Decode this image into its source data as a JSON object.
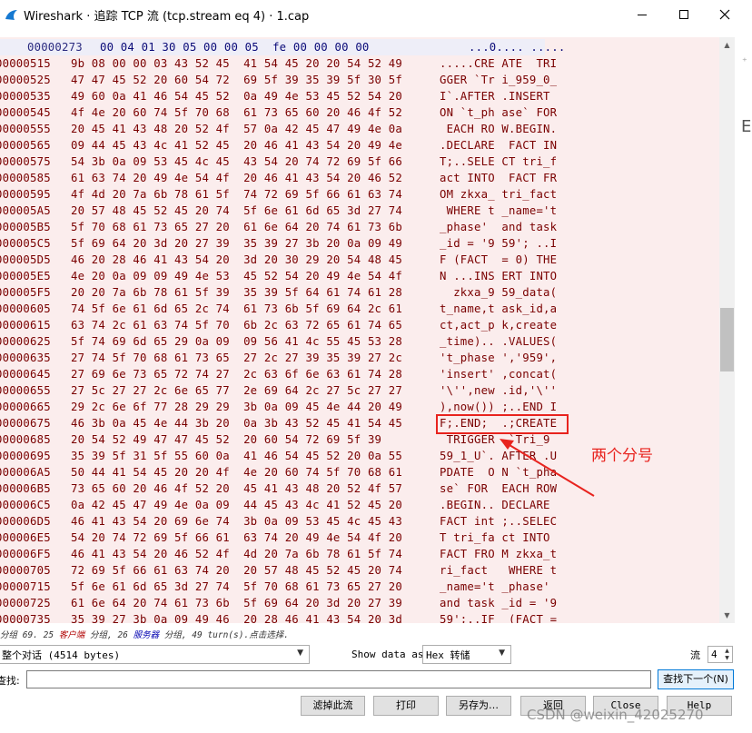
{
  "window": {
    "title": "Wireshark · 追踪 TCP 流 (tcp.stream eq 4) · 1.cap"
  },
  "stream": {
    "header_row": {
      "offset": "00000273",
      "hex": "00 04 01 30 05 00 00 05  fe 00 00 00 00",
      "ascii": "...0.... ....."
    },
    "rows": [
      {
        "offset": "00000515",
        "hex": "9b 08 00 00 03 43 52 45  41 54 45 20 20 54 52 49",
        "ascii": ".....CRE ATE  TRI"
      },
      {
        "offset": "00000525",
        "hex": "47 47 45 52 20 60 54 72  69 5f 39 35 39 5f 30 5f",
        "ascii": "GGER `Tr i_959_0_"
      },
      {
        "offset": "00000535",
        "hex": "49 60 0a 41 46 54 45 52  0a 49 4e 53 45 52 54 20",
        "ascii": "I`.AFTER .INSERT "
      },
      {
        "offset": "00000545",
        "hex": "4f 4e 20 60 74 5f 70 68  61 73 65 60 20 46 4f 52",
        "ascii": "ON `t_ph ase` FOR"
      },
      {
        "offset": "00000555",
        "hex": "20 45 41 43 48 20 52 4f  57 0a 42 45 47 49 4e 0a",
        "ascii": " EACH RO W.BEGIN."
      },
      {
        "offset": "00000565",
        "hex": "09 44 45 43 4c 41 52 45  20 46 41 43 54 20 49 4e",
        "ascii": ".DECLARE  FACT IN"
      },
      {
        "offset": "00000575",
        "hex": "54 3b 0a 09 53 45 4c 45  43 54 20 74 72 69 5f 66",
        "ascii": "T;..SELE CT tri_f"
      },
      {
        "offset": "00000585",
        "hex": "61 63 74 20 49 4e 54 4f  20 46 41 43 54 20 46 52",
        "ascii": "act INTO  FACT FR"
      },
      {
        "offset": "00000595",
        "hex": "4f 4d 20 7a 6b 78 61 5f  74 72 69 5f 66 61 63 74",
        "ascii": "OM zkxa_ tri_fact"
      },
      {
        "offset": "000005A5",
        "hex": "20 57 48 45 52 45 20 74  5f 6e 61 6d 65 3d 27 74",
        "ascii": " WHERE t _name='t"
      },
      {
        "offset": "000005B5",
        "hex": "5f 70 68 61 73 65 27 20  61 6e 64 20 74 61 73 6b",
        "ascii": "_phase'  and task"
      },
      {
        "offset": "000005C5",
        "hex": "5f 69 64 20 3d 20 27 39  35 39 27 3b 20 0a 09 49",
        "ascii": "_id = '9 59'; ..I"
      },
      {
        "offset": "000005D5",
        "hex": "46 20 28 46 41 43 54 20  3d 20 30 29 20 54 48 45",
        "ascii": "F (FACT  = 0) THE"
      },
      {
        "offset": "000005E5",
        "hex": "4e 20 0a 09 09 49 4e 53  45 52 54 20 49 4e 54 4f",
        "ascii": "N ...INS ERT INTO"
      },
      {
        "offset": "000005F5",
        "hex": "20 20 7a 6b 78 61 5f 39  35 39 5f 64 61 74 61 28",
        "ascii": "  zkxa_9 59_data("
      },
      {
        "offset": "00000605",
        "hex": "74 5f 6e 61 6d 65 2c 74  61 73 6b 5f 69 64 2c 61",
        "ascii": "t_name,t ask_id,a"
      },
      {
        "offset": "00000615",
        "hex": "63 74 2c 61 63 74 5f 70  6b 2c 63 72 65 61 74 65",
        "ascii": "ct,act_p k,create"
      },
      {
        "offset": "00000625",
        "hex": "5f 74 69 6d 65 29 0a 09  09 56 41 4c 55 45 53 28",
        "ascii": "_time).. .VALUES("
      },
      {
        "offset": "00000635",
        "hex": "27 74 5f 70 68 61 73 65  27 2c 27 39 35 39 27 2c",
        "ascii": "'t_phase ','959',"
      },
      {
        "offset": "00000645",
        "hex": "27 69 6e 73 65 72 74 27  2c 63 6f 6e 63 61 74 28",
        "ascii": "'insert' ,concat("
      },
      {
        "offset": "00000655",
        "hex": "27 5c 27 27 2c 6e 65 77  2e 69 64 2c 27 5c 27 27",
        "ascii": "'\\'',new .id,'\\''"
      },
      {
        "offset": "00000665",
        "hex": "29 2c 6e 6f 77 28 29 29  3b 0a 09 45 4e 44 20 49",
        "ascii": "),now()) ;..END I"
      },
      {
        "offset": "00000675",
        "hex": "46 3b 0a 45 4e 44 3b 20  0a 3b 43 52 45 41 54 45",
        "ascii": "F;.END;  .;CREATE"
      },
      {
        "offset": "00000685",
        "hex": "20 54 52 49 47 47 45 52  20 60 54 72 69 5f 39",
        "ascii": " TRIGGER  `Tri_9"
      },
      {
        "offset": "00000695",
        "hex": "35 39 5f 31 5f 55 60 0a  41 46 54 45 52 20 0a 55",
        "ascii": "59_1_U`. AFTER .U"
      },
      {
        "offset": "000006A5",
        "hex": "50 44 41 54 45 20 20 4f  4e 20 60 74 5f 70 68 61",
        "ascii": "PDATE  O N `t_pha"
      },
      {
        "offset": "000006B5",
        "hex": "73 65 60 20 46 4f 52 20  45 41 43 48 20 52 4f 57",
        "ascii": "se` FOR  EACH ROW"
      },
      {
        "offset": "000006C5",
        "hex": "0a 42 45 47 49 4e 0a 09  44 45 43 4c 41 52 45 20",
        "ascii": ".BEGIN.. DECLARE "
      },
      {
        "offset": "000006D5",
        "hex": "46 41 43 54 20 69 6e 74  3b 0a 09 53 45 4c 45 43",
        "ascii": "FACT int ;..SELEC"
      },
      {
        "offset": "000006E5",
        "hex": "54 20 74 72 69 5f 66 61  63 74 20 49 4e 54 4f 20",
        "ascii": "T tri_fa ct INTO "
      },
      {
        "offset": "000006F5",
        "hex": "46 41 43 54 20 46 52 4f  4d 20 7a 6b 78 61 5f 74",
        "ascii": "FACT FRO M zkxa_t"
      },
      {
        "offset": "00000705",
        "hex": "72 69 5f 66 61 63 74 20  20 57 48 45 52 45 20 74",
        "ascii": "ri_fact   WHERE t"
      },
      {
        "offset": "00000715",
        "hex": "5f 6e 61 6d 65 3d 27 74  5f 70 68 61 73 65 27 20",
        "ascii": "_name='t _phase' "
      },
      {
        "offset": "00000725",
        "hex": "61 6e 64 20 74 61 73 6b  5f 69 64 20 3d 20 27 39",
        "ascii": "and task _id = '9"
      },
      {
        "offset": "00000735",
        "hex": "35 39 27 3b 0a 09 49 46  20 28 46 41 43 54 20 3d",
        "ascii": "59';..IF  (FACT ="
      }
    ]
  },
  "annotation": {
    "label": "两个分号"
  },
  "status": {
    "summary_prefix": "分组 69. 25 ",
    "client_label": "客户端",
    "summary_mid": " 分组, 26 ",
    "server_label": "服务器",
    "summary_suffix": " 分组, 49 turn(s).点击选择."
  },
  "controls": {
    "conversation_select": "整个对话 (4514 bytes)",
    "show_data_as_label": "Show data as",
    "show_data_as_value": "Hex 转储",
    "stream_label": "流",
    "stream_value": "4",
    "find_label": "查找:",
    "find_value": "",
    "find_next_button": "查找下一个(N)"
  },
  "buttons": {
    "filter_out": "滤掉此流",
    "print": "打印",
    "save_as": "另存为…",
    "back": "返回",
    "close": "Close",
    "help": "Help"
  },
  "watermark": "CSDN @weixin_42025270"
}
